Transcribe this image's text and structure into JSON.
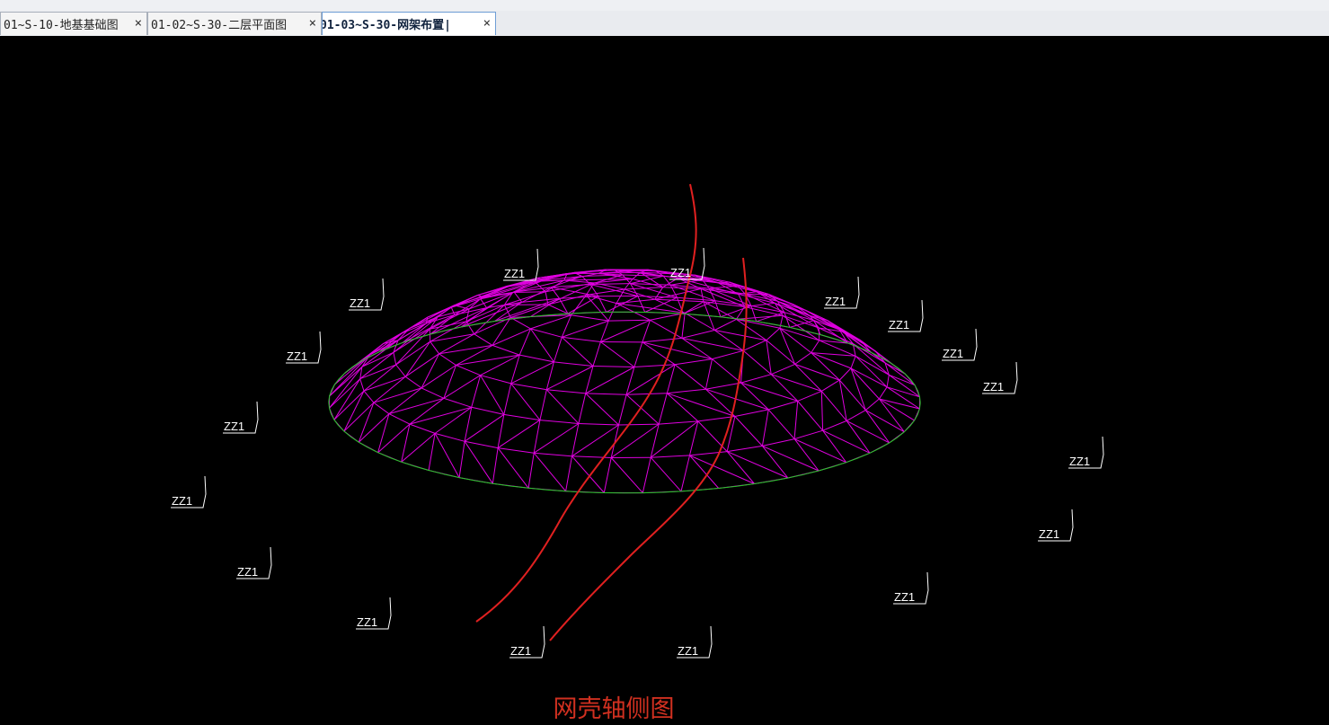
{
  "tabs": [
    {
      "label": "01~S-10-地基基础图",
      "active": false
    },
    {
      "label": "01-02~S-30-二层平面图",
      "active": false
    },
    {
      "label": "01-03~S-30-网架布置|",
      "active": true
    }
  ],
  "close_glyph": "×",
  "drawing": {
    "title": "网壳轴侧图",
    "column_label": "ZZ1",
    "colors": {
      "background": "#000000",
      "mesh": "#e000e0",
      "base_ring": "#22cc22",
      "annotation": "#ffffff",
      "markup": "#e02020",
      "title": "#d03020"
    }
  }
}
